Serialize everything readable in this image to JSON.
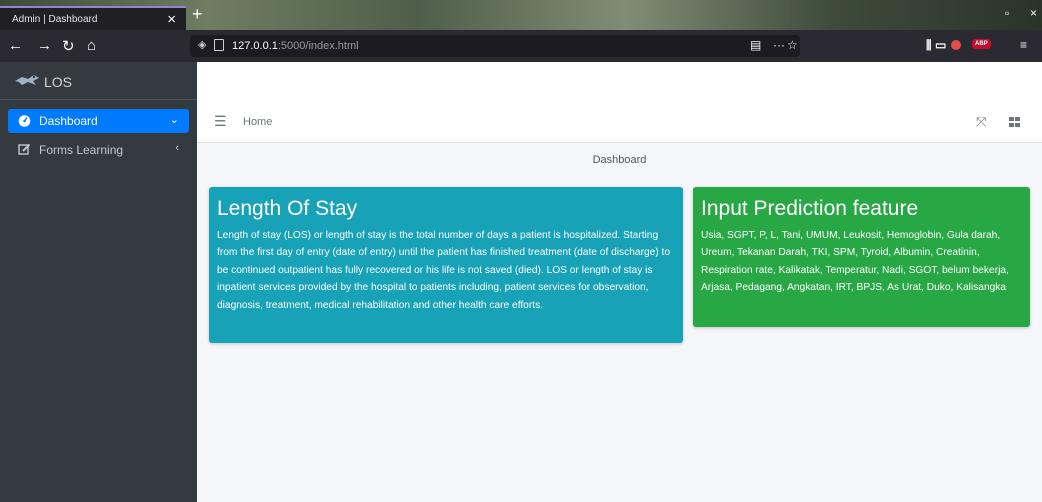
{
  "browser": {
    "tab_title": "Admin | Dashboard",
    "url_host": "127.0.0.1",
    "url_path": ":5000/index.html",
    "url_dots": "···"
  },
  "sidebar": {
    "brand": "LOS",
    "items": [
      {
        "label": "Dashboard",
        "active": true
      },
      {
        "label": "Forms Learning",
        "active": false
      }
    ]
  },
  "header": {
    "home_link": "Home"
  },
  "main": {
    "page_title": "Dashboard",
    "cards": [
      {
        "title": "Length Of Stay",
        "text": "Length of stay (LOS) or length of stay is the total number of days a patient is hospitalized. Starting from the first day of entry (date of entry) until the patient has finished treatment (date of discharge) to be continued outpatient has fully recovered or his life is not saved (died). LOS or length of stay is inpatient services provided by the hospital to patients including, patient services for observation, diagnosis, treatment, medical rehabilitation and other health care efforts.",
        "color": "#17a2b8"
      },
      {
        "title": "Input Prediction feature",
        "text": "Usia, SGPT, P, L, Tani, UMUM, Leukosit, Hemoglobin, Gula darah, Ureum, Tekanan Darah, TKI, SPM, Tyroid, Albumin, Creatinin, Respiration rate, Kalikatak, Temperatur, Nadi, SGOT, belum bekerja, Arjasa, Pedagang, Angkatan, IRT, BPJS, As Urat, Duko, Kalisangka",
        "color": "#28a745"
      }
    ]
  },
  "colors": {
    "sidebar_bg": "#343a40",
    "active_blue": "#007bff"
  }
}
